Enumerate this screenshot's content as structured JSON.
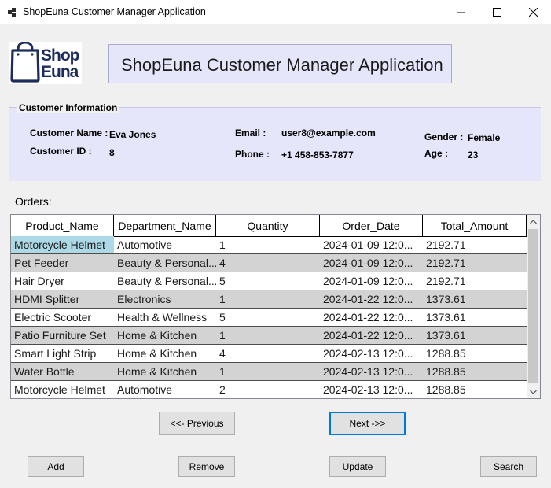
{
  "window": {
    "title": "ShopEuna Customer Manager Application"
  },
  "logo": {
    "line1": "Shop",
    "line2": "Euna"
  },
  "header": {
    "title": "ShopEuna Customer Manager Application"
  },
  "customer_info": {
    "legend": "Customer Information",
    "name_label": "Customer Name :",
    "name_value": "Eva Jones",
    "id_label": "Customer ID :",
    "id_value": "8",
    "email_label": "Email :",
    "email_value": "user8@example.com",
    "phone_label": "Phone :",
    "phone_value": "+1 458-853-7877",
    "gender_label": "Gender :",
    "gender_value": "Female",
    "age_label": "Age :",
    "age_value": "23"
  },
  "orders": {
    "label": "Orders:",
    "columns": [
      "Product_Name",
      "Department_Name",
      "Quantity",
      "Order_Date",
      "Total_Amount"
    ],
    "rows": [
      [
        "Motorcycle Helmet",
        "Automotive",
        "1",
        "2024-01-09 12:0...",
        "2192.71"
      ],
      [
        "Pet Feeder",
        "Beauty & Personal...",
        "4",
        "2024-01-09 12:0...",
        "2192.71"
      ],
      [
        "Hair Dryer",
        "Beauty & Personal...",
        "5",
        "2024-01-09 12:0...",
        "2192.71"
      ],
      [
        "HDMI Splitter",
        "Electronics",
        "1",
        "2024-01-22 12:0...",
        "1373.61"
      ],
      [
        "Electric Scooter",
        "Health & Wellness",
        "5",
        "2024-01-22 12:0...",
        "1373.61"
      ],
      [
        "Patio Furniture Set",
        "Home & Kitchen",
        "1",
        "2024-01-22 12:0...",
        "1373.61"
      ],
      [
        "Smart Light Strip",
        "Home & Kitchen",
        "4",
        "2024-02-13 12:0...",
        "1288.85"
      ],
      [
        "Water Bottle",
        "Home & Kitchen",
        "1",
        "2024-02-13 12:0...",
        "1288.85"
      ],
      [
        "Motorcycle Helmet",
        "Automotive",
        "2",
        "2024-02-13 12:0...",
        "1288.85"
      ]
    ]
  },
  "pagination": {
    "previous_label": "<<- Previous",
    "next_label": "Next ->>"
  },
  "actions": {
    "add_label": "Add",
    "remove_label": "Remove",
    "update_label": "Update",
    "search_label": "Search"
  },
  "colors": {
    "panel": "#e6e6fa",
    "selected_cell": "#add8e6",
    "alt_row": "#d3d3d3",
    "logo_navy": "#1d2c5a",
    "focus_border": "#0078d7"
  }
}
